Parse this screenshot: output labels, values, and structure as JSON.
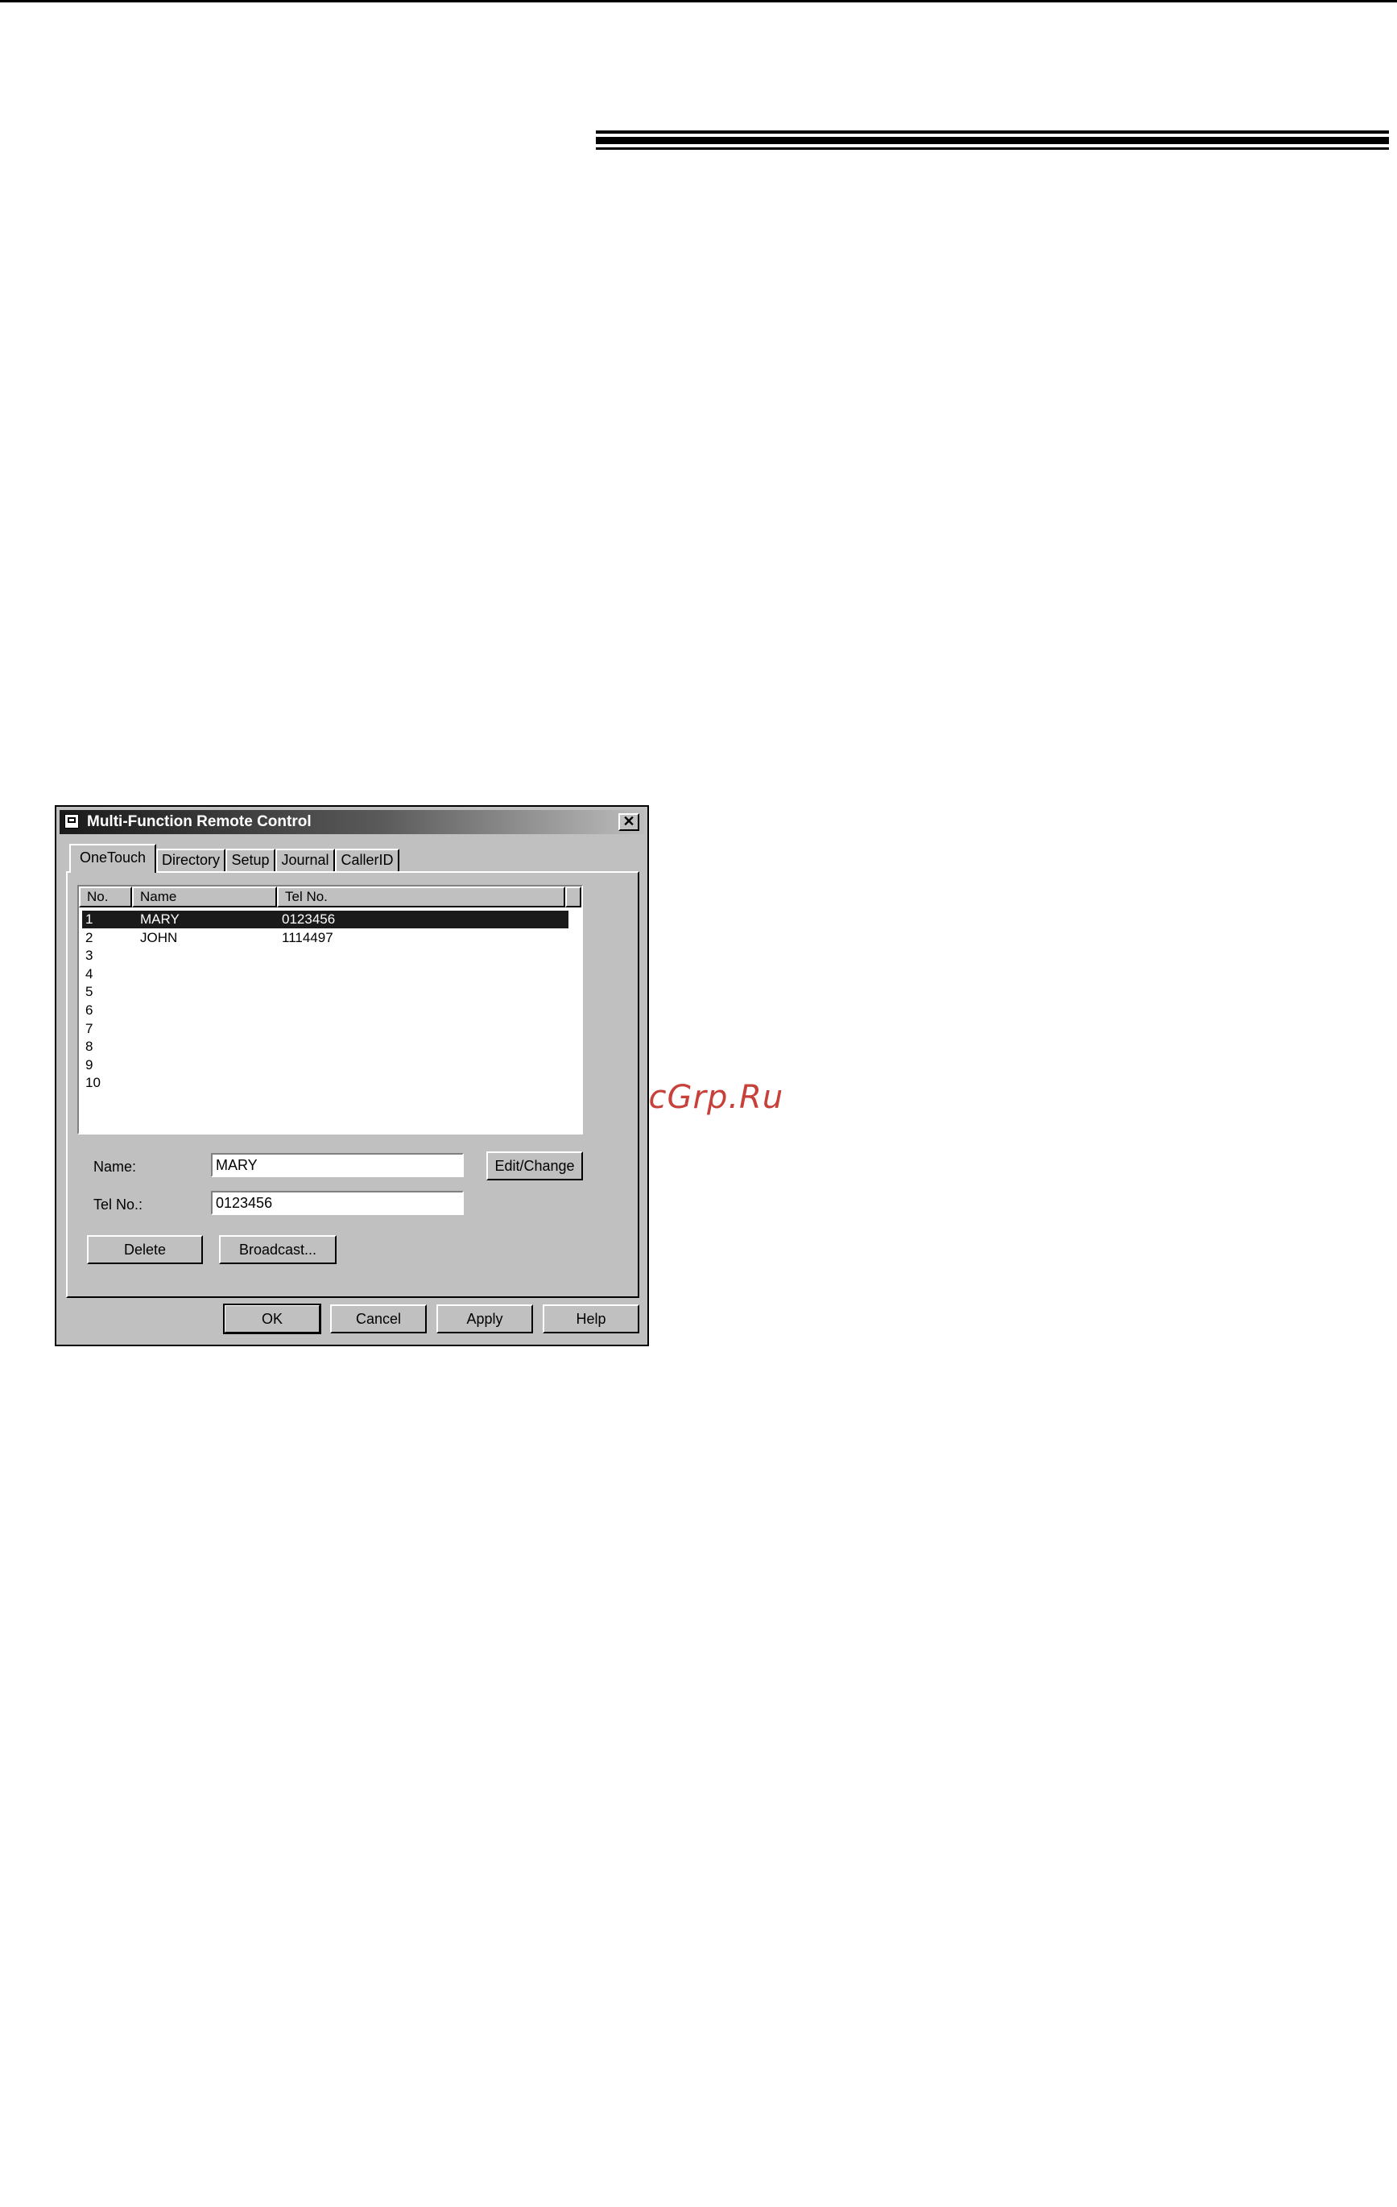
{
  "watermark": "McGrp.Ru",
  "dialog": {
    "title": "Multi-Function Remote Control",
    "close_glyph": "✕",
    "tabs": [
      "OneTouch",
      "Directory",
      "Setup",
      "Journal",
      "CallerID"
    ],
    "active_tab": "OneTouch",
    "columns": [
      "No.",
      "Name",
      "Tel No."
    ],
    "rows": [
      {
        "no": "1",
        "name": "MARY",
        "tel": "0123456",
        "selected": true
      },
      {
        "no": "2",
        "name": "JOHN",
        "tel": "1114497"
      },
      {
        "no": "3",
        "name": "",
        "tel": ""
      },
      {
        "no": "4",
        "name": "",
        "tel": ""
      },
      {
        "no": "5",
        "name": "",
        "tel": ""
      },
      {
        "no": "6",
        "name": "",
        "tel": ""
      },
      {
        "no": "7",
        "name": "",
        "tel": ""
      },
      {
        "no": "8",
        "name": "",
        "tel": ""
      },
      {
        "no": "9",
        "name": "",
        "tel": ""
      },
      {
        "no": "10",
        "name": "",
        "tel": ""
      }
    ],
    "name_label": "Name:",
    "name_value": "MARY",
    "tel_label": "Tel No.:",
    "tel_value": "0123456",
    "edit_button": "Edit/Change",
    "delete_button": "Delete",
    "broadcast_button": "Broadcast...",
    "ok_button": "OK",
    "cancel_button": "Cancel",
    "apply_button": "Apply",
    "help_button": "Help"
  }
}
